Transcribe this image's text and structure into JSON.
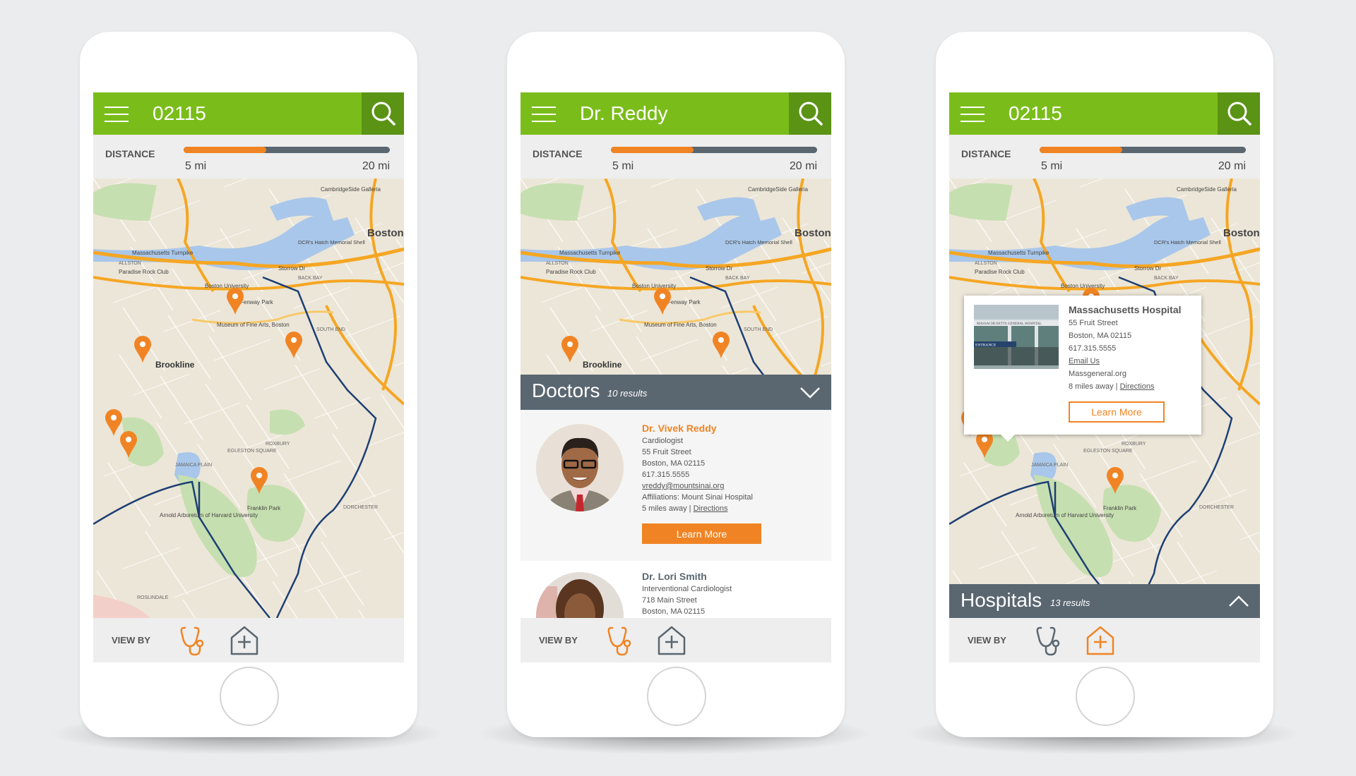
{
  "colors": {
    "brand_green": "#7abd1a",
    "search_green": "#5b9315",
    "accent_orange": "#f08424",
    "slate": "#5a6670",
    "route_navy": "#1d3f73"
  },
  "common": {
    "distance_label": "DISTANCE",
    "min_label": "5 mi",
    "max_label": "20 mi",
    "distance_fill_percent": 40,
    "view_by_label": "VIEW BY",
    "learn_more": "Learn More",
    "icons": {
      "menu": "hamburger-icon",
      "search": "search-icon",
      "doctor": "stethoscope-icon",
      "hospital": "hospital-plus-icon"
    }
  },
  "map_labels": {
    "brookline": "Brookline",
    "boston": "Boston",
    "fenway": "Fenway Park",
    "museum": "Museum of Fine Arts, Boston",
    "bu": "Boston University",
    "franklin": "Franklin Park",
    "arboretum": "Arnold Arboretum of Harvard University",
    "jamaica": "JAMAICA PLAIN",
    "roxbury": "ROXBURY",
    "dorchester": "DORCHESTER",
    "backbay": "BACK BAY",
    "allston": "ALLSTON",
    "galleria": "CambridgeSide Galleria",
    "hatch": "DCR's Hatch Memorial Shell",
    "paradise": "Paradise Rock Club",
    "southend": "SOUTH END",
    "egleston": "EGLESTON SQUARE",
    "roslindale": "ROSLINDALE",
    "mass_tpk": "Massachusetts Turnpike",
    "storrow": "Storrow Dr"
  },
  "phones": [
    {
      "search_text": "02115",
      "view_by_active": "doctors"
    },
    {
      "search_text": "Dr. Reddy",
      "view_by_active": "doctors",
      "list": {
        "title": "Doctors",
        "count": "10 results",
        "state": "expanded",
        "doctors": [
          {
            "name": "Dr. Vivek Reddy",
            "specialty": "Cardiologist",
            "street": "55 Fruit Street",
            "city": "Boston, MA 02115",
            "phone": "617.315.5555",
            "email": "vreddy@mountsinai.org",
            "affiliations": "Affiliations: Mount Sinai Hospital",
            "distance": "5 miles away |",
            "directions": "Directions"
          },
          {
            "name": "Dr. Lori Smith",
            "specialty": "Interventional Cardiologist",
            "street": "718 Main Street",
            "city": "Boston, MA 02115"
          }
        ]
      }
    },
    {
      "search_text": "02115",
      "view_by_active": "hospitals",
      "list": {
        "title": "Hospitals",
        "count": "13 results",
        "state": "collapsed"
      },
      "popup": {
        "name": "Massachusetts Hospital",
        "street": "55 Fruit Street",
        "city": "Boston, MA 02115",
        "phone": "617.315.5555",
        "email": "Email Us",
        "website": "Massgeneral.org",
        "distance": "8 miles away |",
        "directions": "Directions",
        "photo_sign": "MASSACHUSETTS GENERAL HOSPITAL",
        "photo_entrance": "ENTRANCE"
      }
    }
  ]
}
